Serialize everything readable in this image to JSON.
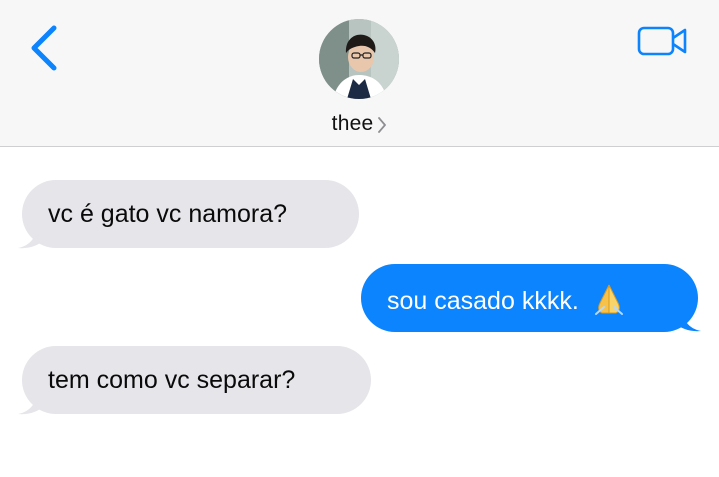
{
  "header": {
    "contact_name": "thee",
    "back_icon": "chevron-left-icon",
    "video_icon": "video-camera-icon",
    "accent": "#0b84fe"
  },
  "messages": [
    {
      "direction": "incoming",
      "text": "vc é gato vc namora?"
    },
    {
      "direction": "outgoing",
      "text": "sou casado kkkk.",
      "emoji": "folded-hands-icon"
    },
    {
      "direction": "incoming",
      "text": "tem como vc separar?"
    }
  ],
  "colors": {
    "incoming_bubble": "#e5e5ea",
    "outgoing_bubble": "#0b84fe",
    "header_bg": "#f7f7f7"
  }
}
